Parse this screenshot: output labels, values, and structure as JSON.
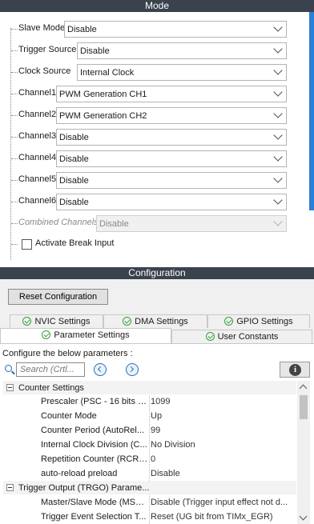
{
  "mode": {
    "title": "Mode",
    "fields": [
      {
        "label": "Slave Mode",
        "value": "Disable"
      },
      {
        "label": "Trigger Source",
        "value": "Disable"
      },
      {
        "label": "Clock Source",
        "value": "Internal Clock"
      },
      {
        "label": "Channel1",
        "value": "PWM Generation CH1"
      },
      {
        "label": "Channel2",
        "value": "PWM Generation CH2"
      },
      {
        "label": "Channel3",
        "value": "Disable"
      },
      {
        "label": "Channel4",
        "value": "Disable"
      },
      {
        "label": "Channel5",
        "value": "Disable"
      },
      {
        "label": "Channel6",
        "value": "Disable"
      },
      {
        "label": "Combined Channels",
        "value": "Disable"
      }
    ],
    "break_input_label": "Activate Break Input"
  },
  "config": {
    "title": "Configuration",
    "reset_label": "Reset Configuration",
    "tabs": {
      "nvic": "NVIC Settings",
      "dma": "DMA Settings",
      "gpio": "GPIO Settings",
      "params": "Parameter Settings",
      "user": "User Constants"
    },
    "configure_text": "Configure the below parameters :",
    "search_placeholder": "Search (Crtl...",
    "groups": [
      {
        "label": "Counter Settings",
        "rows": [
          {
            "name": "Prescaler (PSC - 16 bits v...",
            "value": "1099"
          },
          {
            "name": "Counter Mode",
            "value": "Up"
          },
          {
            "name": "Counter Period (AutoRel...",
            "value": "99"
          },
          {
            "name": "Internal Clock Division (C...",
            "value": "No Division"
          },
          {
            "name": "Repetition Counter (RCR ...",
            "value": "0"
          },
          {
            "name": "auto-reload preload",
            "value": "Disable"
          }
        ]
      },
      {
        "label": "Trigger Output (TRGO) Parame...",
        "rows": [
          {
            "name": "Master/Slave Mode (MSM...",
            "value": "Disable (Trigger input effect not d..."
          },
          {
            "name": "Trigger Event Selection T...",
            "value": "Reset (UG bit from TIMx_EGR)"
          }
        ]
      }
    ]
  },
  "colors": {
    "header_bg": "#39424d",
    "accent": "#2b7fd4",
    "check_green": "#3aa03a"
  }
}
